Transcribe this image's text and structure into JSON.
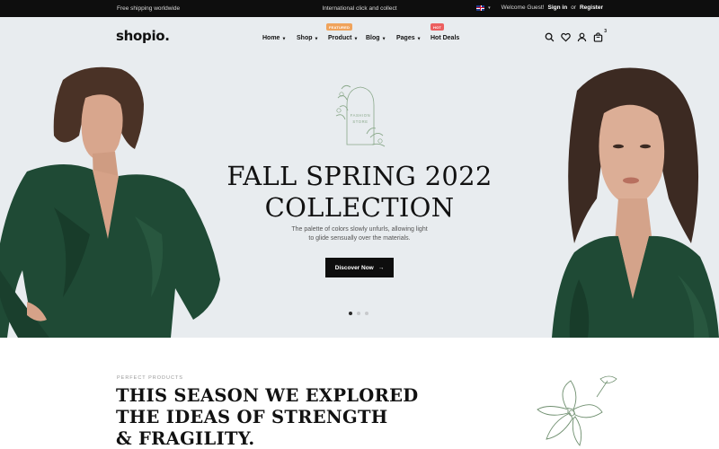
{
  "topbar": {
    "shipping": "Free shipping worldwide",
    "click_collect": "International click and collect",
    "welcome": "Welcome Guest!",
    "sign_in": "Sign in",
    "or": "or",
    "register": "Register"
  },
  "brand": {
    "logo": "shopio",
    "logo_dot": "."
  },
  "nav": {
    "items": [
      {
        "label": "Home",
        "badge": ""
      },
      {
        "label": "Shop",
        "badge": ""
      },
      {
        "label": "Product",
        "badge": "FEATURED"
      },
      {
        "label": "Blog",
        "badge": ""
      },
      {
        "label": "Pages",
        "badge": ""
      },
      {
        "label": "Hot Deals",
        "badge": "HOT"
      }
    ],
    "cart_count": "3",
    "icons": [
      "search-icon",
      "heart-icon",
      "user-icon",
      "cart-icon"
    ]
  },
  "hero": {
    "emblem_line1": "FASHION",
    "emblem_line2": "STORE",
    "title_line1": "FALL SPRING 2022",
    "title_line2": "COLLECTION",
    "subtitle_line1": "The palette of colors slowly unfurls, allowing light",
    "subtitle_line2": "to glide sensually over the materials.",
    "cta": "Discover Now",
    "slides_total": 3,
    "active_slide": 1
  },
  "section": {
    "eyebrow": "PERFECT PRODUCTS",
    "title_line1": "THIS SEASON WE EXPLORED",
    "title_line2": "THE IDEAS OF STRENGTH",
    "title_line3": "& FRAGILITY."
  },
  "colors": {
    "topbar_bg": "#0e0e0e",
    "hero_bg": "#e8ecef",
    "featured_badge": "#f0a35b",
    "hot_badge": "#ec5f5f",
    "garment_green": "#1f4a35",
    "botanical_green": "#8aa88a"
  }
}
